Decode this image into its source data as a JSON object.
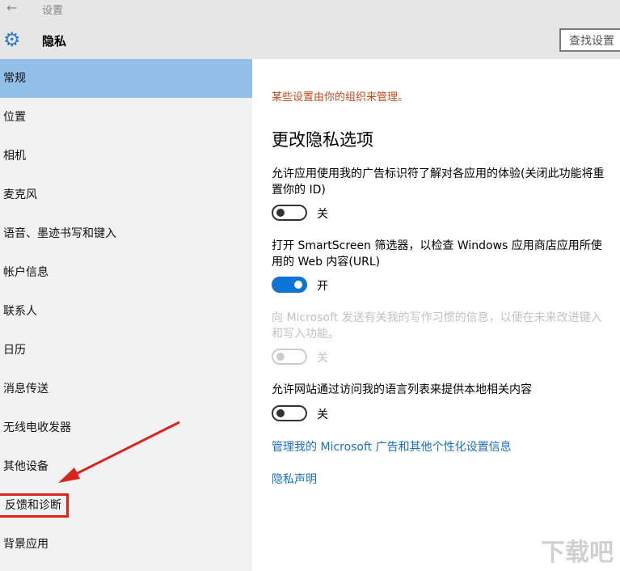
{
  "header": {
    "back_icon": "back-arrow-icon",
    "app_title": "设置",
    "page_icon": "gear-icon",
    "page_title": "隐私",
    "search_placeholder": "查找设置"
  },
  "sidebar": {
    "items": [
      {
        "label": "常规"
      },
      {
        "label": "位置"
      },
      {
        "label": "相机"
      },
      {
        "label": "麦克风"
      },
      {
        "label": "语音、墨迹书写和键入"
      },
      {
        "label": "帐户信息"
      },
      {
        "label": "联系人"
      },
      {
        "label": "日历"
      },
      {
        "label": "消息传送"
      },
      {
        "label": "无线电收发器"
      },
      {
        "label": "其他设备"
      },
      {
        "label": "反馈和诊断"
      },
      {
        "label": "背景应用"
      }
    ]
  },
  "main": {
    "org_notice": "某些设置由你的组织来管理。",
    "heading": "更改隐私选项",
    "settings": [
      {
        "line1": "允许应用使用我的广告标识符了解对各应用的体验(关闭此功能将重",
        "line2": "置你的 ID)",
        "state": "关",
        "on": false,
        "disabled": false
      },
      {
        "line1": "打开 SmartScreen 筛选器，以检查 Windows 应用商店应用所使",
        "line2": "用的 Web 内容(URL)",
        "state": "开",
        "on": true,
        "disabled": false
      },
      {
        "line1": "向 Microsoft 发送有关我的写作习惯的信息，以便在未来改进键入",
        "line2": "和写入功能。",
        "state": "关",
        "on": false,
        "disabled": true
      },
      {
        "line1": "允许网站通过访问我的语言列表来提供本地相关内容",
        "state": "关",
        "on": false,
        "disabled": false
      }
    ],
    "link_ads": "管理我的 Microsoft 广告和其他个性化设置信息",
    "link_privacy": "隐私声明"
  },
  "watermark": "下载吧",
  "colors": {
    "accent": "#0f74d3",
    "selected": "#92c0e8",
    "notice": "#c9481c",
    "annotation": "#d9241c"
  }
}
